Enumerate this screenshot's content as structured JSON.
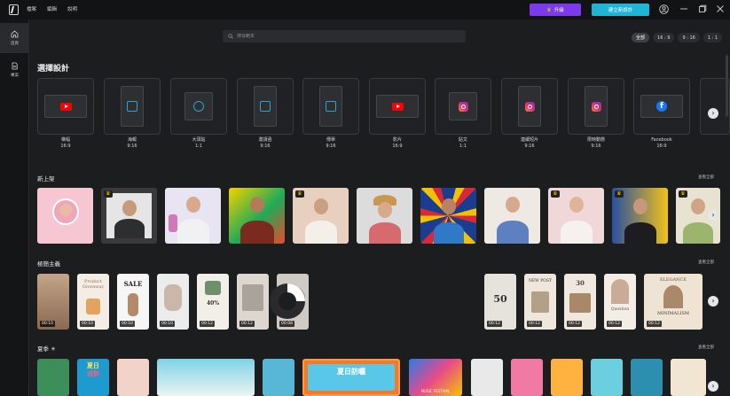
{
  "menu": [
    "檔案",
    "編輯",
    "說明"
  ],
  "titlebar": {
    "upgrade_label": "升級",
    "create_label": "建立新設計"
  },
  "sidebar": {
    "items": [
      {
        "label": "首頁",
        "icon": "home-icon"
      },
      {
        "label": "專案",
        "icon": "document-icon"
      }
    ]
  },
  "search": {
    "placeholder": "搜尋範本"
  },
  "filters": [
    "全部",
    "16 : 9",
    "9 : 16",
    "1 : 1"
  ],
  "section_title": "選擇設計",
  "presets": [
    {
      "name": "橫幅",
      "ratio": "16:9",
      "icon": "youtube-icon"
    },
    {
      "name": "海報",
      "ratio": "9:16",
      "icon": "poster-icon"
    },
    {
      "name": "大頭貼",
      "ratio": "1:1",
      "icon": "avatar-icon"
    },
    {
      "name": "邀請函",
      "ratio": "9:16",
      "icon": "invitation-icon"
    },
    {
      "name": "傳單",
      "ratio": "9:16",
      "icon": "flyer-icon"
    },
    {
      "name": "影片",
      "ratio": "16:9",
      "icon": "youtube-icon"
    },
    {
      "name": "貼文",
      "ratio": "1:1",
      "icon": "instagram-icon"
    },
    {
      "name": "連續短片",
      "ratio": "9:16",
      "icon": "instagram-icon"
    },
    {
      "name": "限時動態",
      "ratio": "9:16",
      "icon": "instagram-icon"
    },
    {
      "name": "Facebook",
      "ratio": "16:9",
      "icon": "facebook-icon"
    }
  ],
  "rows": [
    {
      "title": "新上架",
      "see_all": "查看全部"
    },
    {
      "title": "極簡主義",
      "see_all": "查看全部"
    },
    {
      "title": "夏季 ☀",
      "see_all": "查看全部"
    }
  ],
  "minimal_durations": [
    "00:10",
    "00:10",
    "00:10",
    "00:10",
    "00:12",
    "00:12",
    "00:08",
    "",
    "00:12",
    "00:12",
    "00:12",
    "00:12",
    "00:12"
  ],
  "minimal_texts": {
    "product": "Product Giveaway",
    "sale": "SALE",
    "percent": "40%",
    "fifty": "50",
    "thirty": "30",
    "question": "Question",
    "minimalism": "MINIMALISM",
    "new_post": "NEW POST",
    "elegance": "ELEGANCE"
  },
  "summer_texts": {
    "a": "夏日",
    "b": "派對",
    "c": "夏日防曬",
    "d": "MUSIC FESTIVAL"
  },
  "colors": {
    "upgrade": "#7c3aed",
    "create": "#1fb5d6",
    "crown": "#f3c300"
  }
}
